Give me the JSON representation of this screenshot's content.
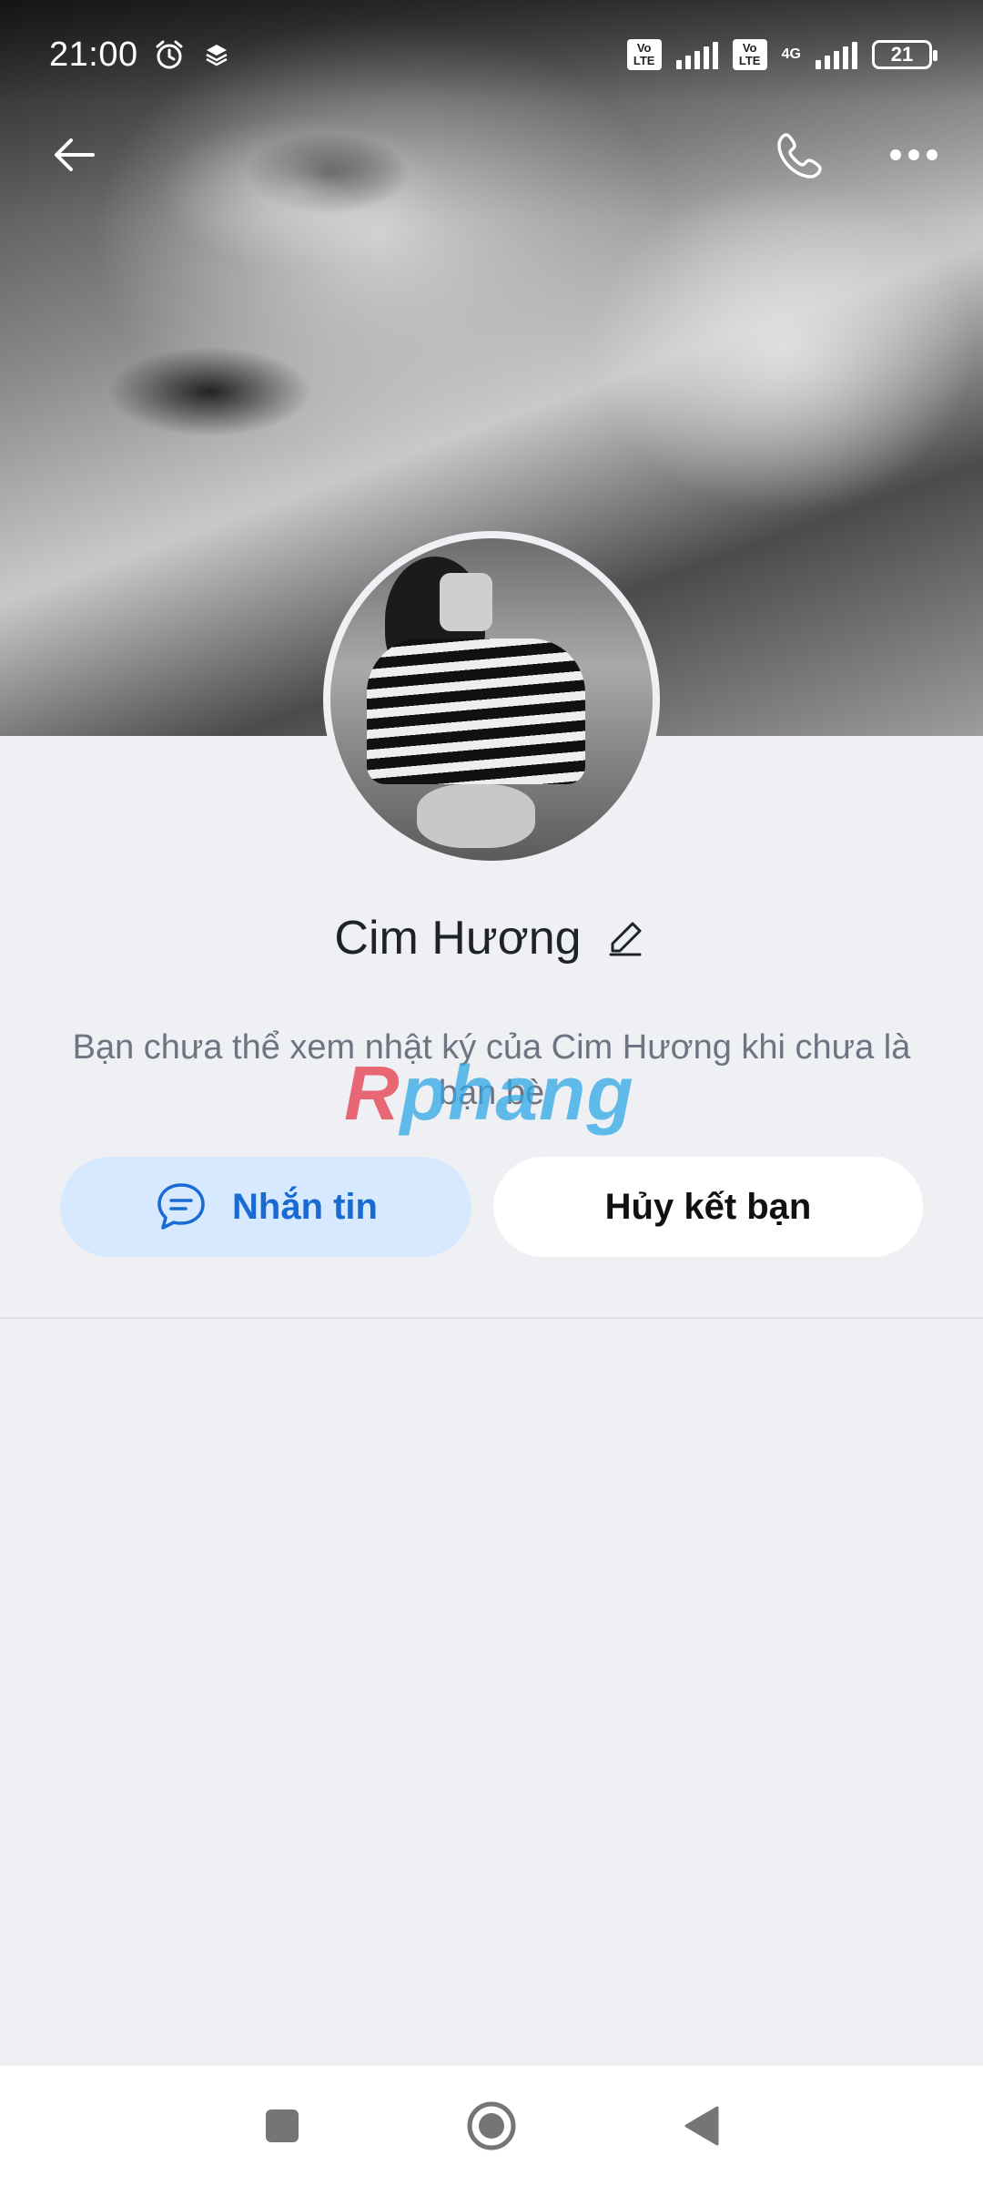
{
  "status_bar": {
    "time": "21:00",
    "network_type": "4G",
    "battery": "21",
    "volte_label_1": "Vo LTE",
    "volte_label_2": "Vo LTE"
  },
  "header": {
    "back_icon": "arrow-left-icon",
    "call_icon": "phone-icon",
    "more_icon": "more-horizontal-icon"
  },
  "profile": {
    "name": "Cim Hương",
    "info_text": "Bạn chưa thể xem nhật ký của Cim Hương khi chưa là bạn bè"
  },
  "watermark": {
    "part1": "R",
    "part2": "phang"
  },
  "actions": {
    "message_label": "Nhắn tin",
    "unfriend_label": "Hủy kết bạn"
  },
  "colors": {
    "accent": "#1a6ad4",
    "message_button_bg": "#d6e9ff",
    "page_bg": "#eff0f4"
  }
}
